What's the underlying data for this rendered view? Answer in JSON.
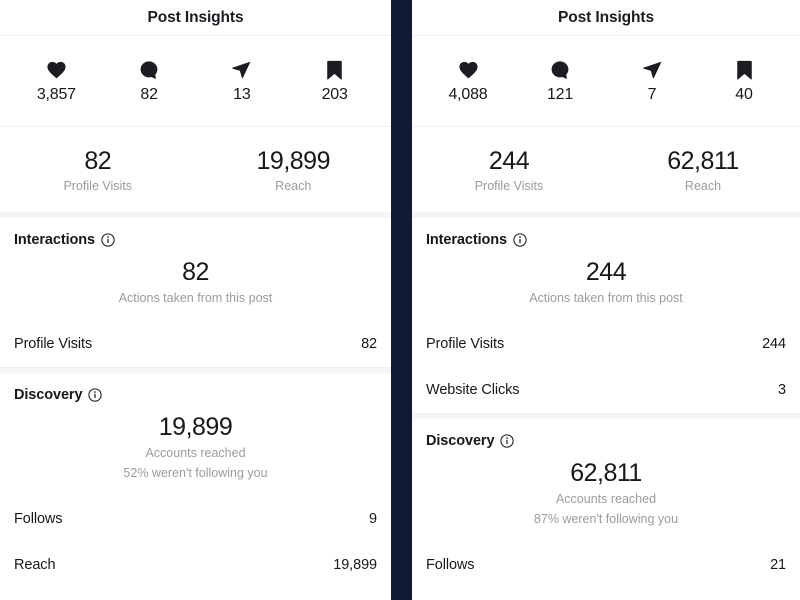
{
  "divider_color": "#111a33",
  "text_color": "#16181c",
  "muted_color": "#9a9ba1",
  "panels": [
    {
      "id": "left",
      "header": {
        "title": "Post Insights"
      },
      "engagement": [
        {
          "icon": "heart-icon",
          "label": "Likes",
          "value": "3,857"
        },
        {
          "icon": "comment-icon",
          "label": "Comments",
          "value": "82"
        },
        {
          "icon": "share-icon",
          "label": "Shares",
          "value": "13"
        },
        {
          "icon": "bookmark-icon",
          "label": "Saves",
          "value": "203"
        }
      ],
      "summary": [
        {
          "value": "82",
          "label": "Profile Visits"
        },
        {
          "value": "19,899",
          "label": "Reach"
        }
      ],
      "interactions": {
        "title": "Interactions",
        "info_icon": "info-icon",
        "hero_value": "82",
        "hero_caption": "Actions taken from this post",
        "rows": [
          {
            "name": "Profile Visits",
            "value": "82"
          }
        ]
      },
      "discovery": {
        "title": "Discovery",
        "info_icon": "info-icon",
        "hero_value": "19,899",
        "hero_caption_line1": "Accounts reached",
        "hero_caption_line2": "52% weren't following you",
        "rows": [
          {
            "name": "Follows",
            "value": "9"
          },
          {
            "name": "Reach",
            "value": "19,899"
          }
        ]
      }
    },
    {
      "id": "right",
      "header": {
        "title": "Post Insights"
      },
      "engagement": [
        {
          "icon": "heart-icon",
          "label": "Likes",
          "value": "4,088"
        },
        {
          "icon": "comment-icon",
          "label": "Comments",
          "value": "121"
        },
        {
          "icon": "share-icon",
          "label": "Shares",
          "value": "7"
        },
        {
          "icon": "bookmark-icon",
          "label": "Saves",
          "value": "40"
        }
      ],
      "summary": [
        {
          "value": "244",
          "label": "Profile Visits"
        },
        {
          "value": "62,811",
          "label": "Reach"
        }
      ],
      "interactions": {
        "title": "Interactions",
        "info_icon": "info-icon",
        "hero_value": "244",
        "hero_caption": "Actions taken from this post",
        "rows": [
          {
            "name": "Profile Visits",
            "value": "244"
          },
          {
            "name": "Website Clicks",
            "value": "3"
          }
        ]
      },
      "discovery": {
        "title": "Discovery",
        "info_icon": "info-icon",
        "hero_value": "62,811",
        "hero_caption_line1": "Accounts reached",
        "hero_caption_line2": "87% weren't following you",
        "rows": [
          {
            "name": "Follows",
            "value": "21"
          }
        ]
      }
    }
  ]
}
